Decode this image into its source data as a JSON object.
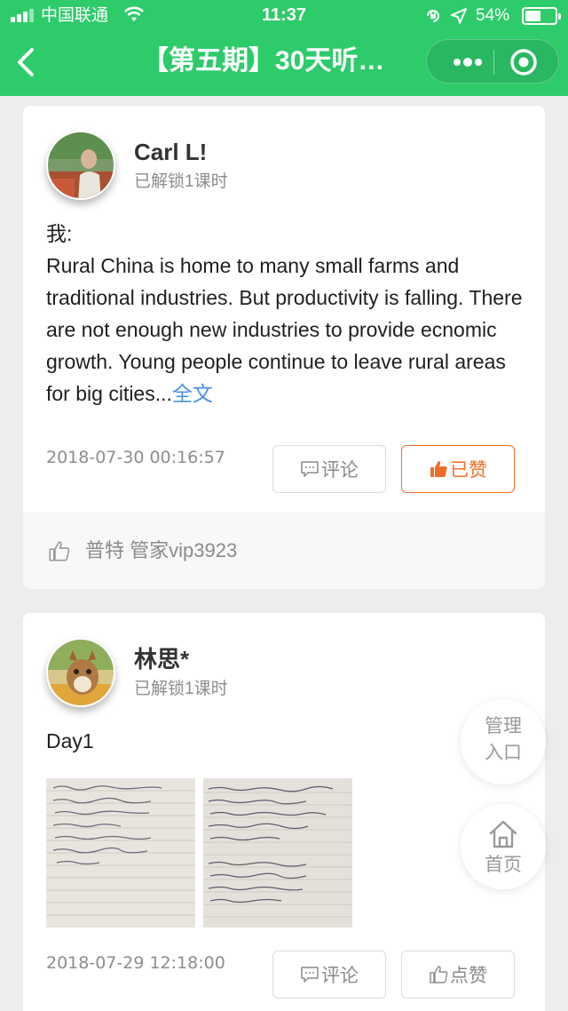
{
  "status_bar": {
    "carrier": "中国联通",
    "time": "11:37",
    "battery": "54%"
  },
  "nav": {
    "title": "【第五期】30天听…"
  },
  "posts": [
    {
      "user": "Carl L!",
      "unlocked": "已解锁1课时",
      "label": "我:",
      "text": "Rural China is home to many small farms and traditional industries. But productivity is falling. There are not enough new industries to provide ecnomic growth. Young people continue to leave rural areas for big cities...",
      "fulltext_link": "全文",
      "date": "2018-07-30 00:16:57",
      "comment_label": "评论",
      "like_label": "已赞",
      "liked": true,
      "liked_by": "普特 管家vip3923"
    },
    {
      "user": "林思*",
      "unlocked": "已解锁1课时",
      "text": "Day1",
      "date": "2018-07-29 12:18:00",
      "comment_label": "评论",
      "like_label": "点赞",
      "liked": false
    }
  ],
  "floating": {
    "manage_line1": "管理",
    "manage_line2": "入口",
    "home_label": "首页"
  },
  "colors": {
    "brand_green": "#2ecb6b",
    "liked_orange": "#f06e2a",
    "link_blue": "#4a90d9"
  },
  "icons": [
    "signal-icon",
    "wifi-icon",
    "lock-rotation-icon",
    "location-icon",
    "battery-icon",
    "back-icon",
    "more-icon",
    "close-circle-icon",
    "comment-icon",
    "thumbs-up-icon",
    "home-icon"
  ]
}
